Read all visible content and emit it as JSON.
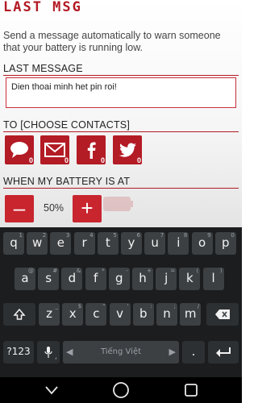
{
  "app": {
    "title": "LAST MSG",
    "description": "Send a message automatically to warn someone that your battery is running low.",
    "last_message_label": "LAST MESSAGE",
    "message_text": "Dien thoai minh het pin roi!",
    "contacts_label": "TO [CHOOSE CONTACTS]",
    "contacts": [
      {
        "icon": "sms-icon",
        "count": "0"
      },
      {
        "icon": "email-icon",
        "count": "0"
      },
      {
        "icon": "facebook-icon",
        "count": "0"
      },
      {
        "icon": "twitter-icon",
        "count": "0"
      }
    ],
    "battery_label": "WHEN MY BATTERY IS AT",
    "decrease_label": "–",
    "battery_value": "50%",
    "increase_label": "+"
  },
  "keyboard": {
    "row1": [
      {
        "key": "q",
        "hint": "1"
      },
      {
        "key": "w",
        "hint": "2"
      },
      {
        "key": "e",
        "hint": "3"
      },
      {
        "key": "r",
        "hint": "4"
      },
      {
        "key": "t",
        "hint": "5"
      },
      {
        "key": "y",
        "hint": "6"
      },
      {
        "key": "u",
        "hint": "7"
      },
      {
        "key": "i",
        "hint": "8"
      },
      {
        "key": "o",
        "hint": "9"
      },
      {
        "key": "p",
        "hint": "0"
      }
    ],
    "row2": [
      {
        "key": "a",
        "hint": "@"
      },
      {
        "key": "s",
        "hint": "#"
      },
      {
        "key": "d",
        "hint": "&"
      },
      {
        "key": "f",
        "hint": "*"
      },
      {
        "key": "g",
        "hint": "-"
      },
      {
        "key": "h",
        "hint": "+"
      },
      {
        "key": "j",
        "hint": "="
      },
      {
        "key": "k",
        "hint": "("
      },
      {
        "key": "l",
        "hint": ")"
      }
    ],
    "row3": [
      {
        "key": "z",
        "hint": "_"
      },
      {
        "key": "x",
        "hint": "$"
      },
      {
        "key": "c",
        "hint": "\""
      },
      {
        "key": "v",
        "hint": "'"
      },
      {
        "key": "b",
        "hint": ":"
      },
      {
        "key": "n",
        "hint": ";"
      },
      {
        "key": "m",
        "hint": "/"
      }
    ],
    "shift_icon": "shift-icon",
    "backspace_icon": "backspace-icon",
    "symbols_label": "?123",
    "mic_icon": "mic-icon",
    "comma_label": ",",
    "space_label": "Tiếng Việt",
    "period_label": ".",
    "enter_icon": "enter-icon"
  },
  "navbar": {
    "back_icon": "back-chevron-icon",
    "home_icon": "home-circle-icon",
    "recents_icon": "recents-square-icon"
  },
  "colors": {
    "accent": "#b31b25",
    "keyboard_bg": "#1b1d1f",
    "key_bg": "#3c4043"
  }
}
